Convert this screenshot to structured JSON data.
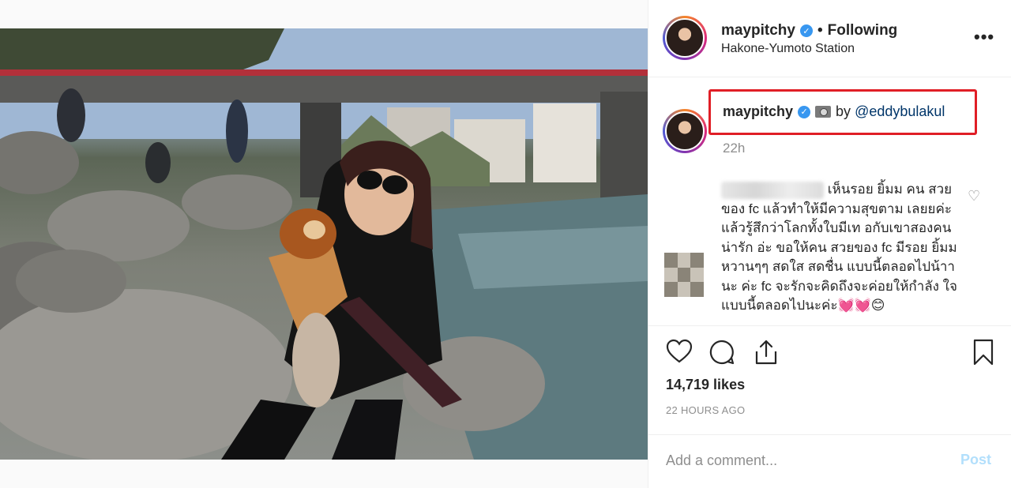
{
  "post": {
    "username": "maypitchy",
    "verified_mark": "✓",
    "separator": "•",
    "follow_status": "Following",
    "location": "Hakone-Yumoto Station",
    "more_icon": "more-horizontal-icon"
  },
  "caption": {
    "username": "maypitchy",
    "text_prefix": "by ",
    "mention": "@eddybulakul",
    "time": "22h",
    "highlight_color": "#e01e26"
  },
  "comment": {
    "text": "เห็นรอย ยิ้มม คน สวยของ fc แล้วทำให้มีความสุขตาม เลยยค่ะ แล้วรู้สึกว่าโลกทั้งใบมีเท อกับเขาสองคน น่ารัก อ่ะ ขอให้คน สวยของ fc มีรอย ยิ้มมหวานๆๆ สดใส สดชื่น แบบนี้ตลอดไปน้าานะ ค่ะ fc จะรักจะคิดถึงจะค่อยให้กำลัง ใจแบบนี้ตลอดไปนะค่ะ💓💓😊"
  },
  "actions": {
    "likes": "14,719 likes",
    "timestamp": "22 HOURS AGO"
  },
  "add_comment": {
    "placeholder": "Add a comment...",
    "post_label": "Post"
  },
  "colors": {
    "verified": "#3897f0",
    "post_disabled": "#b2dffc",
    "mention": "#003569"
  }
}
